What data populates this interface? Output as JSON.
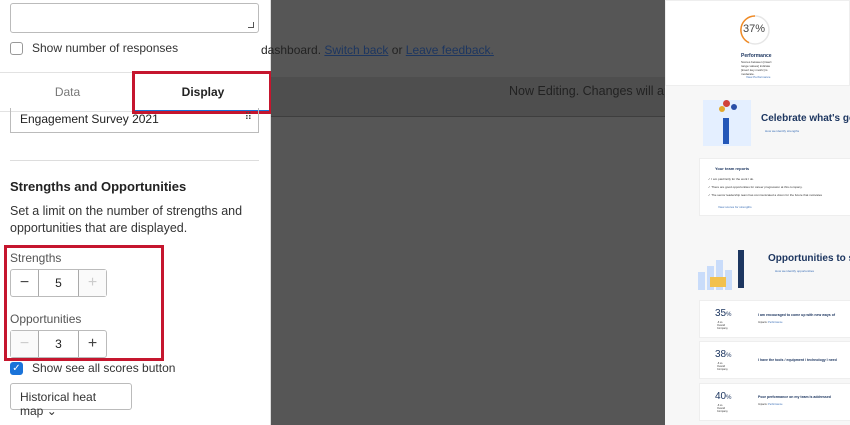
{
  "left_panel": {
    "show_responses_label": "Show number of responses",
    "tabs": [
      {
        "label": "Data"
      },
      {
        "label": "Display"
      }
    ],
    "survey_select": "Engagement Survey 2021",
    "section_title": "Strengths and Opportunities",
    "section_desc": "Set a limit on the number of strengths and opportunities that are displayed.",
    "strengths_label": "Strengths",
    "strengths_value": "5",
    "opportunities_label": "Opportunities",
    "opportunities_value": "3",
    "show_see_all_label": "Show see all scores button",
    "heatmap_dropdown": "Historical heat map"
  },
  "middle": {
    "banner_prefix": "dashboard.",
    "switch_back": "Switch back",
    "or": "or",
    "leave_feedback": "Leave feedback.",
    "edit_notice": "Now Editing. Changes will app"
  },
  "preview": {
    "gauge_value": "37%",
    "gauge_title": "Performance",
    "gauge_desc": "Scores between [insert range values] indicate [insert key metric] is moderate.",
    "gauge_link": "View Performance",
    "celebrate_title": "Celebrate what's going",
    "celebrate_link": "How we identify strengths",
    "team_reports_title": "Your team reports",
    "team_reports": [
      "I am paid fairly for the work I do.",
      "There are good opportunities for career progression at this company.",
      "The senior leadership team has communicated a vision for the future that motivates"
    ],
    "team_reports_link": "View scores for strengths",
    "opps_title": "Opportunities to supp",
    "opps_link": "How we identify opportunities",
    "opps": [
      {
        "value": "35",
        "unit": "%",
        "compare": "-6 vs. Overall Company",
        "text": "I am encouraged to come up with new ways of",
        "impacts": "Impacts:",
        "impact_link": "Performance"
      },
      {
        "value": "38",
        "unit": "%",
        "compare": "-6 vs. Overall Company",
        "text": "I have the tools / equipment / technology I need"
      },
      {
        "value": "40",
        "unit": "%",
        "compare": "-6 vs. Overall Company",
        "text": "Poor performance on my team is addressed",
        "impacts": "Impacts:",
        "impact_link": "Performance"
      }
    ]
  },
  "colors": {
    "accent": "#1a73d9",
    "highlight": "#c5162e",
    "navy": "#1d3660",
    "gauge": "#f08a24"
  }
}
